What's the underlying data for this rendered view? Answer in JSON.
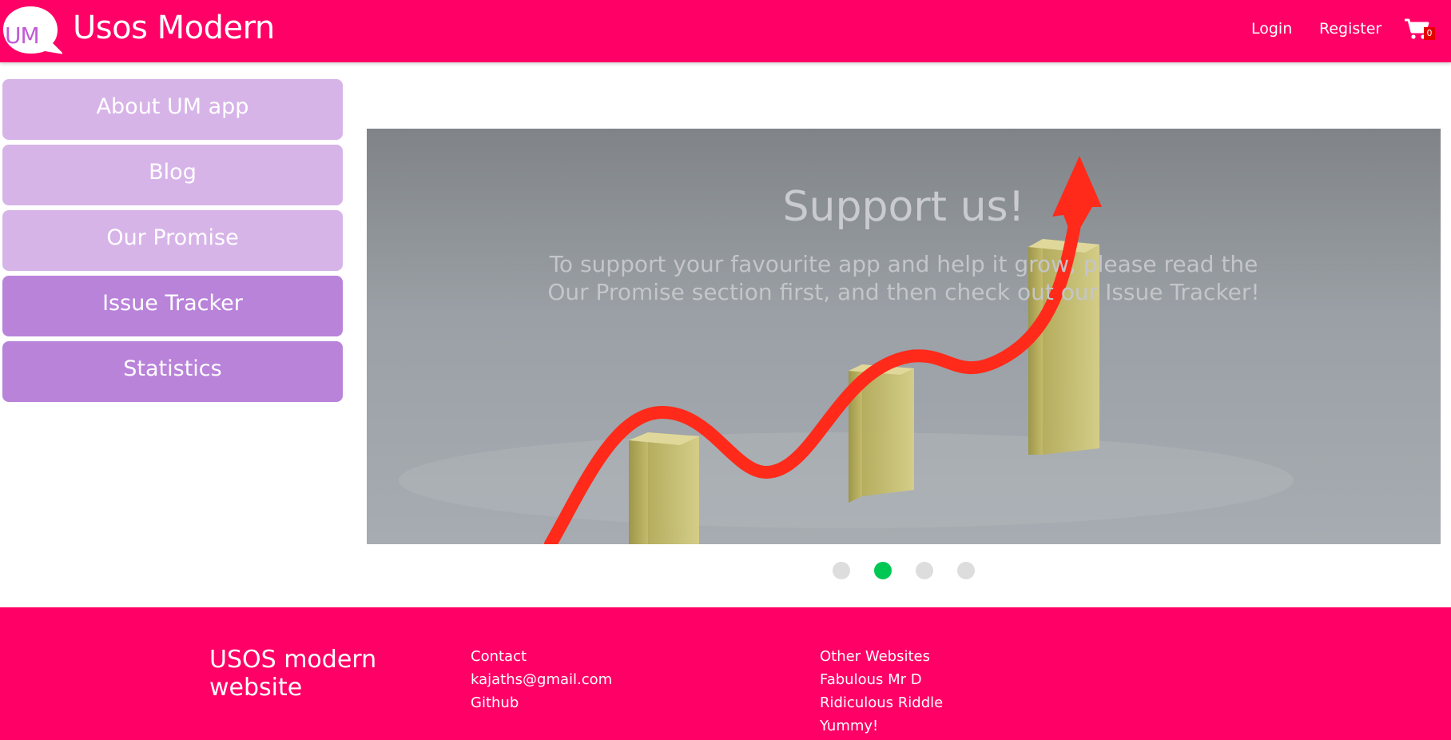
{
  "header": {
    "logo_text": "UM",
    "brand": "Usos Modern",
    "login": "Login",
    "register": "Register",
    "cart_icon": "cart-icon",
    "cart_count": "0",
    "colors": {
      "background": "#ff0066",
      "logo_text": "#c25ad6"
    }
  },
  "sidebar": {
    "items": [
      {
        "label": "About UM app"
      },
      {
        "label": "Blog"
      },
      {
        "label": "Our Promise"
      },
      {
        "label": "Issue Tracker"
      },
      {
        "label": "Statistics"
      }
    ],
    "colors": {
      "light": "#d7b4e8",
      "dark": "#b983da"
    }
  },
  "carousel": {
    "title": "Support us!",
    "text": "To support your favourite app and help it grow, please read the Our Promise section first, and then check out our Issue Tracker!",
    "image": "growth-chart-illustration",
    "slide_count": 4,
    "active_slide": 2,
    "colors": {
      "active_dot": "#00c853",
      "inactive_dot": "#dddddd"
    }
  },
  "footer": {
    "brand": "USOS modern website",
    "contact": {
      "heading": "Contact",
      "email": "kajaths@gmail.com",
      "github": "Github"
    },
    "other": {
      "heading": "Other Websites",
      "links": [
        "Fabulous Mr D",
        "Ridiculous Riddle",
        "Yummy!"
      ]
    }
  }
}
